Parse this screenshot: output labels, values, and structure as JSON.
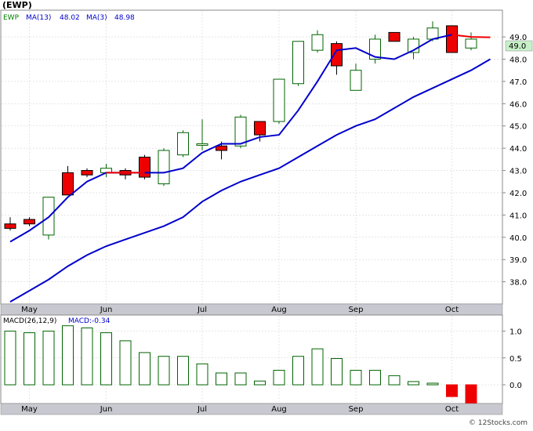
{
  "header": {
    "title": "(EWP)",
    "legend_symbol": "EWP",
    "ma13_label": "MA(13)",
    "ma13_value": "48.02",
    "ma3_label": "MA(3)",
    "ma3_value": "48.98",
    "last_price_badge": "49.0"
  },
  "macd_header": {
    "label": "MACD(26,12,9)",
    "value_label": "MACD:-0.34"
  },
  "watermark": "© 12Stocks.com",
  "colors": {
    "up_body": "#ffffff",
    "up_border": "#006400",
    "down_body": "#ee0000",
    "ma_line": "#0000cc",
    "ma3_recent": "#ee0000",
    "badge_bg": "#c8f0c8",
    "grid": "#cccccc",
    "axis_band": "#c8c8d0"
  },
  "chart_data": [
    {
      "type": "candlestick",
      "title": "(EWP)",
      "ylim": [
        37,
        50.2
      ],
      "yticks": [
        38.0,
        39.0,
        40.0,
        41.0,
        42.0,
        43.0,
        44.0,
        45.0,
        46.0,
        47.0,
        48.0,
        49.0
      ],
      "x_labels": [
        "May",
        "Jun",
        "Jul",
        "Aug",
        "Sep",
        "Oct"
      ],
      "x_label_index": [
        1,
        5,
        10,
        14,
        18,
        23
      ],
      "candles": [
        {
          "o": 40.6,
          "h": 40.9,
          "l": 40.3,
          "c": 40.4
        },
        {
          "o": 40.8,
          "h": 40.9,
          "l": 40.5,
          "c": 40.6
        },
        {
          "o": 40.1,
          "h": 41.8,
          "l": 39.9,
          "c": 41.8
        },
        {
          "o": 42.9,
          "h": 43.2,
          "l": 42.1,
          "c": 41.9
        },
        {
          "o": 43.0,
          "h": 43.1,
          "l": 42.7,
          "c": 42.8
        },
        {
          "o": 42.9,
          "h": 43.3,
          "l": 42.7,
          "c": 43.1
        },
        {
          "o": 43.0,
          "h": 43.1,
          "l": 42.6,
          "c": 42.8
        },
        {
          "o": 43.6,
          "h": 43.7,
          "l": 42.6,
          "c": 42.7
        },
        {
          "o": 42.4,
          "h": 44.0,
          "l": 42.3,
          "c": 43.9
        },
        {
          "o": 43.7,
          "h": 44.8,
          "l": 43.6,
          "c": 44.7
        },
        {
          "o": 44.2,
          "h": 45.3,
          "l": 43.9,
          "c": 44.2
        },
        {
          "o": 44.1,
          "h": 44.3,
          "l": 43.5,
          "c": 43.9
        },
        {
          "o": 44.1,
          "h": 45.5,
          "l": 44.0,
          "c": 45.4
        },
        {
          "o": 45.2,
          "h": 45.2,
          "l": 44.3,
          "c": 44.6
        },
        {
          "o": 45.2,
          "h": 47.1,
          "l": 45.1,
          "c": 47.1
        },
        {
          "o": 46.9,
          "h": 48.8,
          "l": 46.8,
          "c": 48.8
        },
        {
          "o": 48.4,
          "h": 49.3,
          "l": 48.3,
          "c": 49.1
        },
        {
          "o": 48.7,
          "h": 48.8,
          "l": 47.3,
          "c": 47.7
        },
        {
          "o": 46.6,
          "h": 47.8,
          "l": 46.6,
          "c": 47.5
        },
        {
          "o": 48.0,
          "h": 49.1,
          "l": 47.8,
          "c": 48.9
        },
        {
          "o": 49.2,
          "h": 49.2,
          "l": 48.9,
          "c": 48.8
        },
        {
          "o": 48.3,
          "h": 49.0,
          "l": 48.0,
          "c": 48.9
        },
        {
          "o": 48.9,
          "h": 49.7,
          "l": 48.8,
          "c": 49.4
        },
        {
          "o": 49.5,
          "h": 49.5,
          "l": 48.3,
          "c": 48.3
        },
        {
          "o": 48.5,
          "h": 49.2,
          "l": 48.4,
          "c": 48.9
        }
      ],
      "series": [
        {
          "name": "MA(13)",
          "color": "#0000cc",
          "values": [
            37.1,
            37.6,
            38.1,
            38.7,
            39.2,
            39.6,
            39.9,
            40.2,
            40.5,
            40.9,
            41.6,
            42.1,
            42.5,
            42.8,
            43.1,
            43.6,
            44.1,
            44.6,
            45.0,
            45.3,
            45.8,
            46.3,
            46.7,
            47.1,
            47.5,
            48.0
          ]
        },
        {
          "name": "MA(3)",
          "color": "#0000cc",
          "values": [
            39.8,
            40.3,
            40.9,
            41.8,
            42.5,
            42.9,
            42.9,
            42.9,
            42.9,
            43.1,
            43.8,
            44.2,
            44.2,
            44.5,
            44.6,
            45.7,
            47.0,
            48.4,
            48.5,
            48.1,
            48.0,
            48.4,
            48.9,
            49.1,
            49.0,
            48.98
          ],
          "recent_color": "#ee0000"
        }
      ]
    },
    {
      "type": "bar",
      "title": "MACD(26,12,9)",
      "ylim": [
        -0.35,
        1.3
      ],
      "yticks": [
        0.0,
        0.5,
        1.0
      ],
      "values": [
        1.0,
        0.97,
        1.0,
        1.1,
        1.06,
        0.97,
        0.82,
        0.6,
        0.53,
        0.53,
        0.39,
        0.22,
        0.22,
        0.07,
        0.27,
        0.53,
        0.67,
        0.49,
        0.27,
        0.27,
        0.17,
        0.06,
        0.03,
        -0.22,
        -0.34
      ]
    }
  ]
}
